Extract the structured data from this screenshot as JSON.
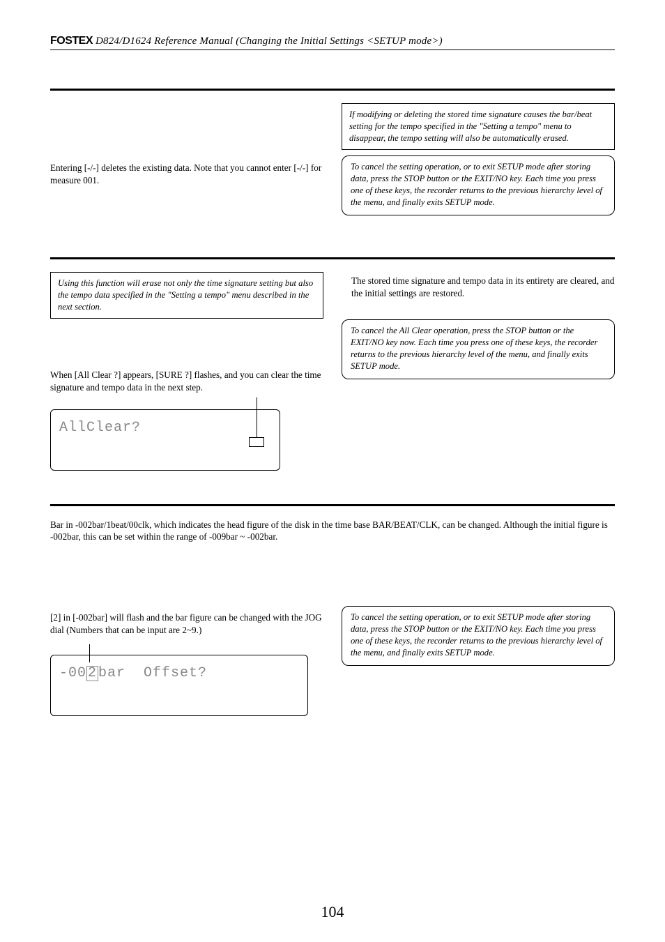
{
  "header": {
    "brand": "FOSTEX",
    "title": " D824/D1624 Reference Manual (Changing the Initial Settings <SETUP mode>)"
  },
  "section1": {
    "left_body": "Entering [-/-] deletes the existing data.  Note that you cannot enter [-/-] for measure 001.",
    "right_box": "If modifying or deleting the stored time signature causes the bar/beat setting for the tempo specified in the \"Setting a tempo\" menu to disappear, the tempo setting will also be automatically erased.",
    "right_rbox": "To cancel the setting operation, or to exit SETUP mode after storing data, press the STOP button or the EXIT/NO key.  Each time you press one of these keys, the recorder returns to the previous hierarchy level of the menu, and finally exits SETUP mode."
  },
  "section2": {
    "left_box": "Using this function will erase not only the time signature setting but also the tempo data specified in the \"Setting a tempo\" menu described in the next section.",
    "left_body": "When [All Clear ?] appears, [SURE ?] flashes, and you can clear the time signature and tempo data in the next step.",
    "lcd": "AllClear?",
    "right_body": "The stored time signature and tempo data in its entirety are cleared, and the initial settings are restored.",
    "right_rbox": "To cancel the All Clear operation, press the STOP button or the EXIT/NO key now.  Each time you press one of these keys, the recorder returns to the previous hierarchy level of the menu, and finally exits SETUP mode."
  },
  "section3": {
    "intro": "Bar in -002bar/1beat/00clk, which indicates the head figure of the disk in the time base BAR/BEAT/CLK, can be changed. Although the initial figure is -002bar, this can be set within the range of -009bar ~ -002bar.",
    "left_body": "[2] in [-002bar] will flash and the bar figure can be changed with the JOG dial (Numbers that can be input are 2~9.)",
    "lcd_prefix": "-00",
    "lcd_boxed": "2",
    "lcd_suffix": "bar  Offset?",
    "right_rbox": "To cancel the setting operation, or to exit SETUP mode after storing data, press the STOP button or the EXIT/NO key.  Each time you press one of these keys, the recorder returns to the previous hierarchy level of the menu, and finally exits SETUP mode."
  },
  "page_number": "104"
}
